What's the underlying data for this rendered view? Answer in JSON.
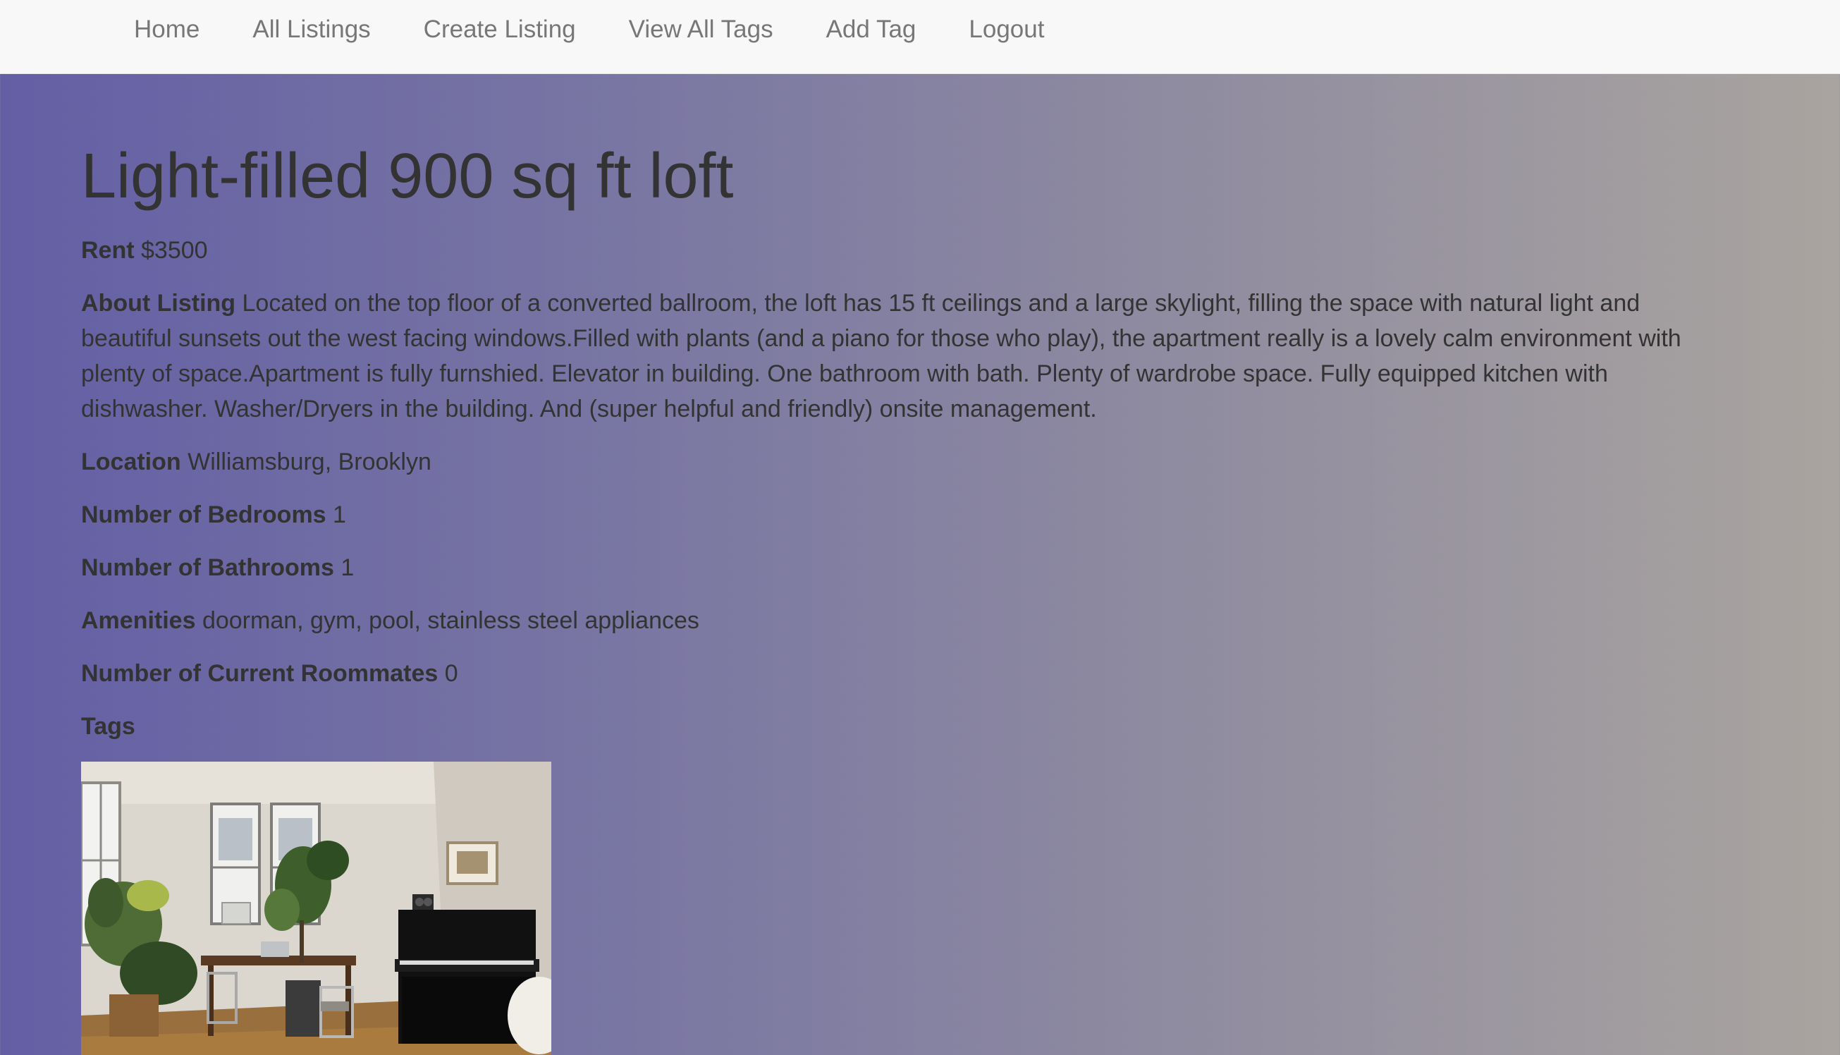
{
  "nav": {
    "items": [
      "Home",
      "All Listings",
      "Create Listing",
      "View All Tags",
      "Add Tag",
      "Logout"
    ]
  },
  "listing": {
    "title": "Light-filled 900 sq ft loft",
    "rent_label": "Rent",
    "rent_value": "$3500",
    "about_label": "About Listing",
    "about_value": "Located on the top floor of a converted ballroom, the loft has 15 ft ceilings and a large skylight, filling the space with natural light and beautiful sunsets out the west facing windows.Filled with plants (and a piano for those who play), the apartment really is a lovely calm environment with plenty of space.Apartment is fully furnshied. Elevator in building. One bathroom with bath. Plenty of wardrobe space. Fully equipped kitchen with dishwasher. Washer/Dryers in the building. And (super helpful and friendly) onsite management.",
    "location_label": "Location",
    "location_value": "Williamsburg, Brooklyn",
    "bedrooms_label": "Number of Bedrooms",
    "bedrooms_value": "1",
    "bathrooms_label": "Number of Bathrooms",
    "bathrooms_value": "1",
    "amenities_label": "Amenities",
    "amenities_value": "doorman, gym, pool, stainless steel appliances",
    "roommates_label": "Number of Current Roommates",
    "roommates_value": "0",
    "tags_label": "Tags"
  }
}
